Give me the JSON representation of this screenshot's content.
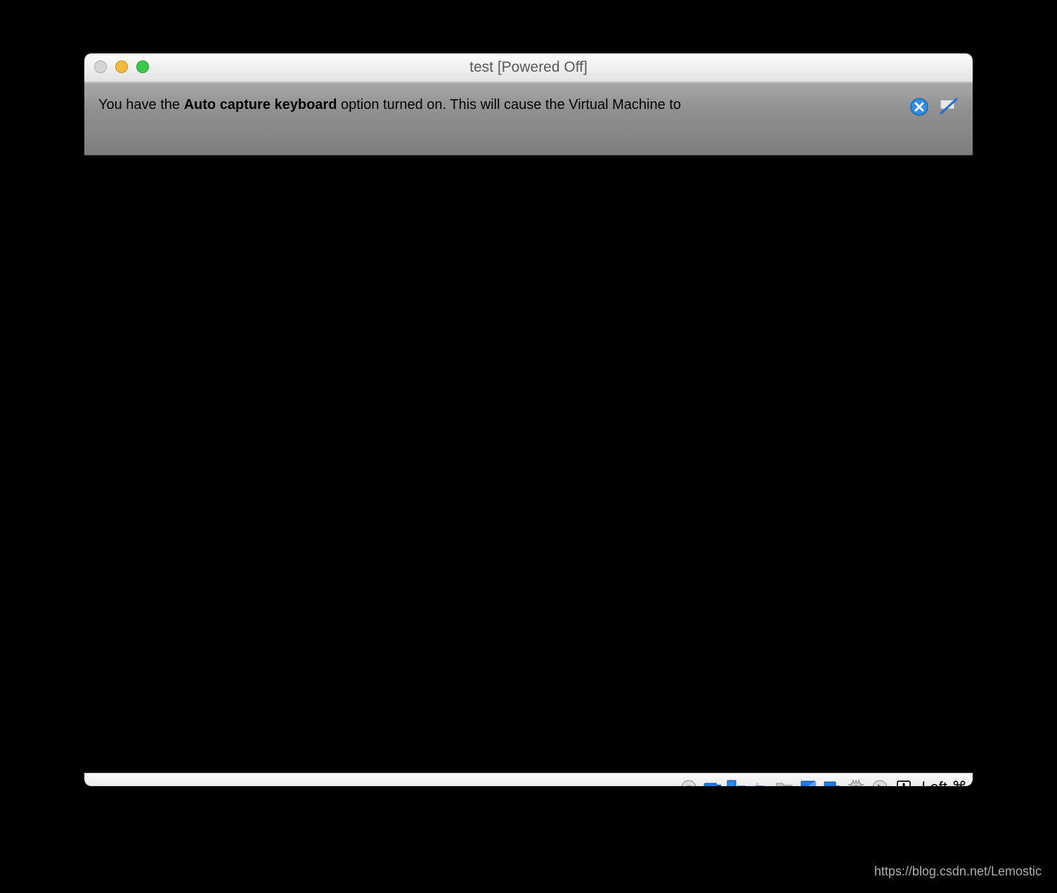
{
  "titlebar": {
    "title": "test [Powered Off]"
  },
  "notification": {
    "text_before": "You have the ",
    "text_bold": "Auto capture keyboard",
    "text_after": " option turned on. This will cause the Virtual Machine to"
  },
  "statusbar": {
    "hostkey_label": "Left ⌘"
  },
  "watermark": "https://blog.csdn.net/Lemostic"
}
